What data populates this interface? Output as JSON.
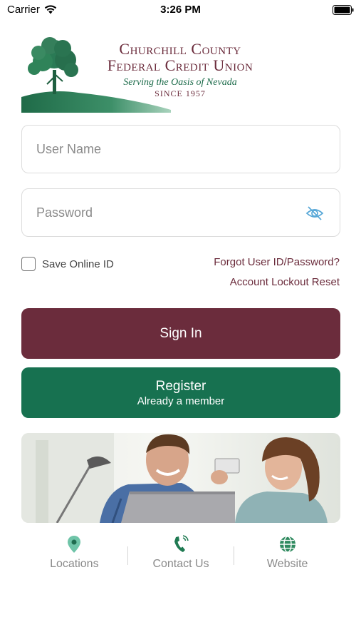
{
  "status_bar": {
    "carrier": "Carrier",
    "time": "3:26 PM"
  },
  "logo": {
    "line1": "Churchill County",
    "line2": "Federal Credit Union",
    "tagline": "Serving the Oasis of Nevada",
    "since": "SINCE 1957"
  },
  "login": {
    "username_placeholder": "User Name",
    "password_placeholder": "Password",
    "save_label": "Save Online ID",
    "save_checked": false,
    "forgot_link": "Forgot User ID/Password?",
    "lockout_link": "Account Lockout Reset"
  },
  "buttons": {
    "signin_label": "Sign In",
    "register_title": "Register",
    "register_subtitle": "Already a member"
  },
  "bottom_nav": {
    "locations": "Locations",
    "contact": "Contact Us",
    "website": "Website"
  },
  "colors": {
    "brand_maroon": "#6b2c3c",
    "brand_green": "#177150"
  }
}
